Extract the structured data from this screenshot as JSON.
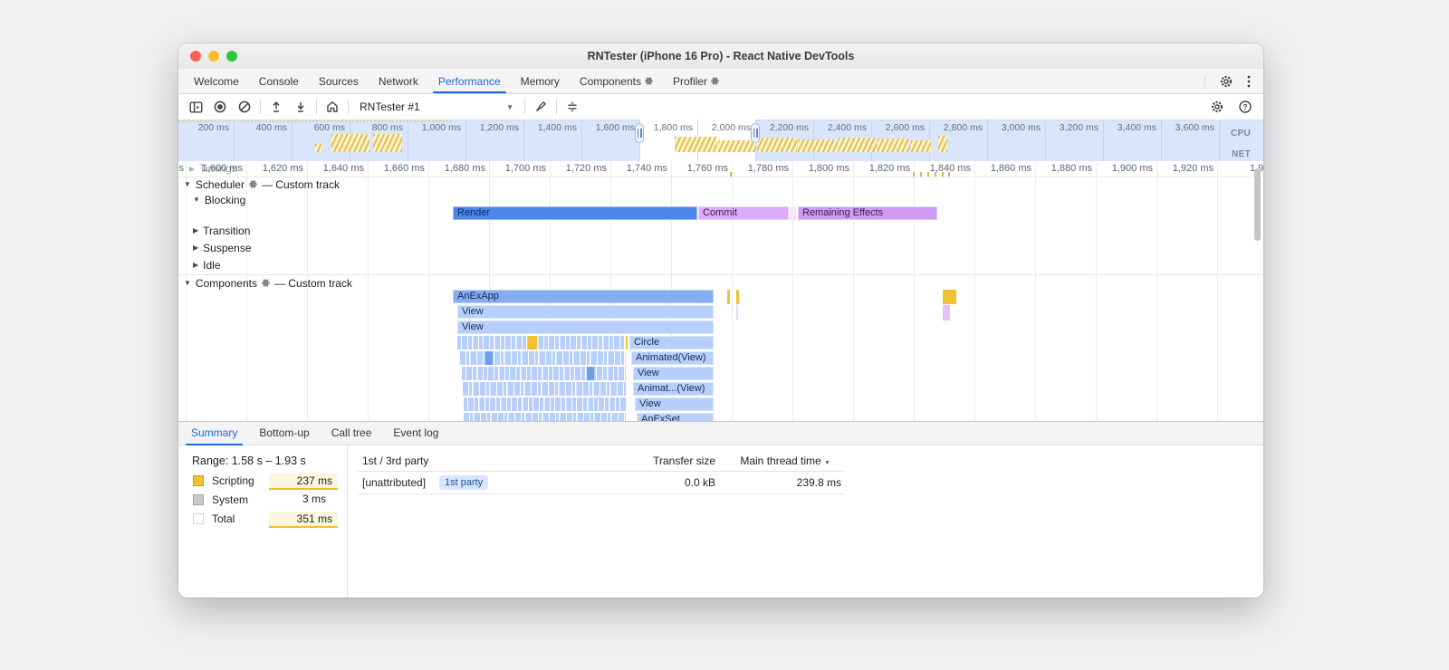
{
  "colors": {
    "accent": "#1a69d4",
    "scripting_yellow": "#f2c131",
    "system_gray": "#c9c9c9",
    "render_blue": "#4b87ea",
    "commit_purple": "#dcaaf7",
    "effects_purple": "#d09af3",
    "flame_blue": "#86acf2",
    "flame_light_blue": "#b7cffa",
    "overview_blue": "#d9e5fa"
  },
  "window": {
    "title": "RNTester (iPhone 16 Pro) - React Native DevTools"
  },
  "tabbar": {
    "tabs": [
      {
        "label": "Welcome",
        "active": false,
        "badge": false
      },
      {
        "label": "Console",
        "active": false,
        "badge": false
      },
      {
        "label": "Sources",
        "active": false,
        "badge": false
      },
      {
        "label": "Network",
        "active": false,
        "badge": false
      },
      {
        "label": "Performance",
        "active": true,
        "badge": false
      },
      {
        "label": "Memory",
        "active": false,
        "badge": false
      },
      {
        "label": "Components",
        "active": false,
        "badge": true
      },
      {
        "label": "Profiler",
        "active": false,
        "badge": true
      }
    ]
  },
  "toolbar": {
    "target": "RNTester #1"
  },
  "overview": {
    "labels": [
      "200 ms",
      "400 ms",
      "600 ms",
      "800 ms",
      "1,000 ms",
      "1,200 ms",
      "1,400 ms",
      "1,600 ms",
      "1,800 ms",
      "2,000 ms",
      "2,200 ms",
      "2,400 ms",
      "2,600 ms",
      "2,800 ms",
      "3,000 ms",
      "3,200 ms",
      "3,400 ms",
      "3,600 ms"
    ],
    "cpu": "CPU",
    "net": "NET"
  },
  "ruler": {
    "labels": [
      "s",
      "1,600 ms",
      "1,620 ms",
      "1,640 ms",
      "1,660 ms",
      "1,680 ms",
      "1,700 ms",
      "1,720 ms",
      "1,740 ms",
      "1,760 ms",
      "1,780 ms",
      "1,800 ms",
      "1,820 ms",
      "1,840 ms",
      "1,860 ms",
      "1,880 ms",
      "1,900 ms",
      "1,920 ms",
      "1,9"
    ]
  },
  "tracks": {
    "timings": "Timings",
    "scheduler": "Scheduler",
    "components": "Components",
    "custom_suffix": "— Custom track",
    "blocking": "Blocking",
    "transition": "Transition",
    "suspense": "Suspense",
    "idle": "Idle"
  },
  "flame": {
    "blocking": [
      {
        "label": "Render"
      },
      {
        "label": "Commit"
      },
      {
        "label": "Remaining Effects"
      }
    ],
    "components": [
      "AnExApp",
      "View",
      "View",
      "Circle",
      "Animated(View)",
      "View",
      "Animat...(View)",
      "View",
      "AnExSet"
    ]
  },
  "bottom": {
    "tabs": [
      {
        "label": "Summary",
        "active": true
      },
      {
        "label": "Bottom-up",
        "active": false
      },
      {
        "label": "Call tree",
        "active": false
      },
      {
        "label": "Event log",
        "active": false
      }
    ],
    "range": "Range: 1.58 s – 1.93 s",
    "legend": [
      {
        "label": "Scripting",
        "value": "237 ms",
        "swatch": "#f2c131",
        "highlight": true
      },
      {
        "label": "System",
        "value": "3 ms",
        "swatch": "#c9c9c9",
        "highlight": false
      },
      {
        "label": "Total",
        "value": "351 ms",
        "swatch": "#ffffff",
        "highlight": true
      }
    ],
    "table": {
      "col_party": "1st / 3rd party",
      "col_transfer": "Transfer size",
      "col_main_thread": "Main thread time",
      "row": {
        "name": "[unattributed]",
        "badge": "1st party",
        "transfer": "0.0 kB",
        "time": "239.8 ms"
      }
    }
  }
}
